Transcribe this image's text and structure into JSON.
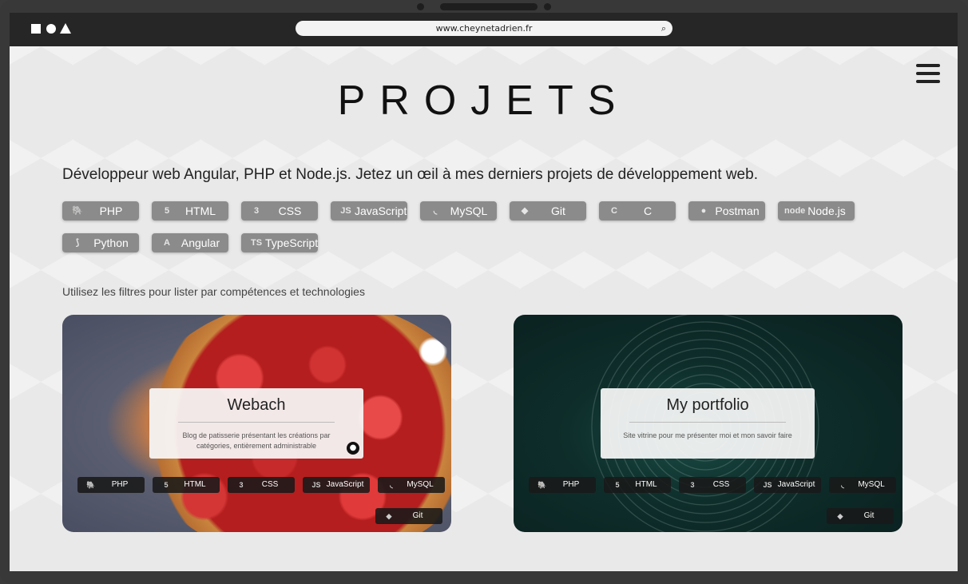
{
  "browser": {
    "url": "www.cheynetadrien.fr",
    "search_icon": "magnifier-icon",
    "window_controls": [
      "square-icon",
      "circle-icon",
      "triangle-icon"
    ]
  },
  "header": {
    "title": "PROJETS",
    "menu_icon": "hamburger-icon"
  },
  "intro": {
    "text": "Développeur web Angular, PHP et Node.js. Jetez un œil à mes derniers projets de développement web."
  },
  "filters": {
    "items": [
      {
        "label": "PHP",
        "icon": "php-elephant-icon",
        "glyph": "🐘"
      },
      {
        "label": "HTML",
        "icon": "html5-icon",
        "glyph": "5"
      },
      {
        "label": "CSS",
        "icon": "css3-icon",
        "glyph": "3"
      },
      {
        "label": "JavaScript",
        "icon": "js-icon",
        "glyph": "JS"
      },
      {
        "label": "MySQL",
        "icon": "mysql-dolphin-icon",
        "glyph": "◟"
      },
      {
        "label": "Git",
        "icon": "git-icon",
        "glyph": "◆"
      },
      {
        "label": "C",
        "icon": "c-language-icon",
        "glyph": "C"
      },
      {
        "label": "Postman",
        "icon": "postman-icon",
        "glyph": "●"
      },
      {
        "label": "Node.js",
        "icon": "nodejs-icon",
        "glyph": "node"
      },
      {
        "label": "Python",
        "icon": "python-icon",
        "glyph": "⟆"
      },
      {
        "label": "Angular",
        "icon": "angular-icon",
        "glyph": "A"
      },
      {
        "label": "TypeScript",
        "icon": "typescript-icon",
        "glyph": "TS"
      }
    ],
    "hint": "Utilisez les filtres pour lister par compétences et technologies"
  },
  "projects": [
    {
      "title": "Webach",
      "description": "Blog de patisserie présentant les créations par catégories, entièrement administrable",
      "github_icon": "github-icon",
      "tags": [
        {
          "label": "PHP",
          "glyph": "🐘"
        },
        {
          "label": "HTML",
          "glyph": "5"
        },
        {
          "label": "CSS",
          "glyph": "3"
        },
        {
          "label": "JavaScript",
          "glyph": "JS"
        },
        {
          "label": "MySQL",
          "glyph": "◟"
        },
        {
          "label": "Git",
          "glyph": "◆"
        }
      ]
    },
    {
      "title": "My portfolio",
      "description": "Site vitrine pour me présenter moi et mon savoir faire",
      "tags": [
        {
          "label": "PHP",
          "glyph": "🐘"
        },
        {
          "label": "HTML",
          "glyph": "5"
        },
        {
          "label": "CSS",
          "glyph": "3"
        },
        {
          "label": "JavaScript",
          "glyph": "JS"
        },
        {
          "label": "MySQL",
          "glyph": "◟"
        },
        {
          "label": "Git",
          "glyph": "◆"
        }
      ]
    }
  ]
}
